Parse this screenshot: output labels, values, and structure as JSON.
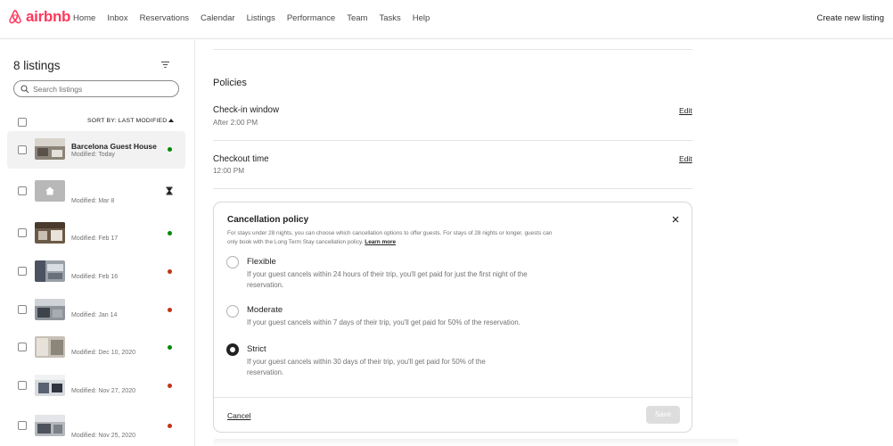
{
  "brand": {
    "name": "airbnb",
    "color": "#ff385c"
  },
  "nav": {
    "items": [
      "Home",
      "Inbox",
      "Reservations",
      "Calendar",
      "Listings",
      "Performance",
      "Team",
      "Tasks",
      "Help"
    ],
    "create_listing": "Create new listing"
  },
  "sidebar": {
    "count_label": "8 listings",
    "search_placeholder": "Search listings",
    "sort_label": "SORT BY: LAST MODIFIED",
    "listings": [
      {
        "title": "Barcelona Guest House",
        "modified": "Modified: Today",
        "status": "active",
        "status_color": "#008a05",
        "thumb": "photo"
      },
      {
        "title": "",
        "modified": "Modified: Mar 8",
        "status": "in-progress",
        "status_icon": "hourglass-icon",
        "thumb": "placeholder"
      },
      {
        "title": "",
        "modified": "Modified: Feb 17",
        "status": "active",
        "status_color": "#008a05",
        "thumb": "photo"
      },
      {
        "title": "",
        "modified": "Modified: Feb 16",
        "status": "unlisted",
        "status_color": "#c13515",
        "thumb": "photo"
      },
      {
        "title": "",
        "modified": "Modified: Jan 14",
        "status": "unlisted",
        "status_color": "#c13515",
        "thumb": "photo"
      },
      {
        "title": "",
        "modified": "Modified: Dec 10, 2020",
        "status": "active",
        "status_color": "#008a05",
        "thumb": "photo"
      },
      {
        "title": "",
        "modified": "Modified: Nov 27, 2020",
        "status": "unlisted",
        "status_color": "#c13515",
        "thumb": "photo"
      },
      {
        "title": "",
        "modified": "Modified: Nov 25, 2020",
        "status": "unlisted",
        "status_color": "#c13515",
        "thumb": "photo"
      }
    ]
  },
  "main": {
    "section_title": "Policies",
    "checkin": {
      "label": "Check-in window",
      "value": "After 2:00 PM",
      "edit": "Edit"
    },
    "checkout": {
      "label": "Checkout time",
      "value": "12:00 PM",
      "edit": "Edit"
    }
  },
  "modal": {
    "title": "Cancellation policy",
    "description": "For stays under 28 nights, you can choose which cancellation options to offer guests. For stays of 28 nights or longer, guests can only book with the Long Term Stay cancellation policy.",
    "learn_more": "Learn more",
    "options": [
      {
        "title": "Flexible",
        "desc": "If your guest cancels within 24 hours of their trip, you'll get paid for just the first night of the reservation.",
        "selected": false
      },
      {
        "title": "Moderate",
        "desc": "If your guest cancels within 7 days of their trip, you'll get paid for 50% of the reservation.",
        "selected": false
      },
      {
        "title": "Strict",
        "desc": "If your guest cancels within 30 days of their trip, you'll get paid for 50% of the reservation.",
        "selected": true
      }
    ],
    "cancel_label": "Cancel",
    "save_label": "Save"
  }
}
